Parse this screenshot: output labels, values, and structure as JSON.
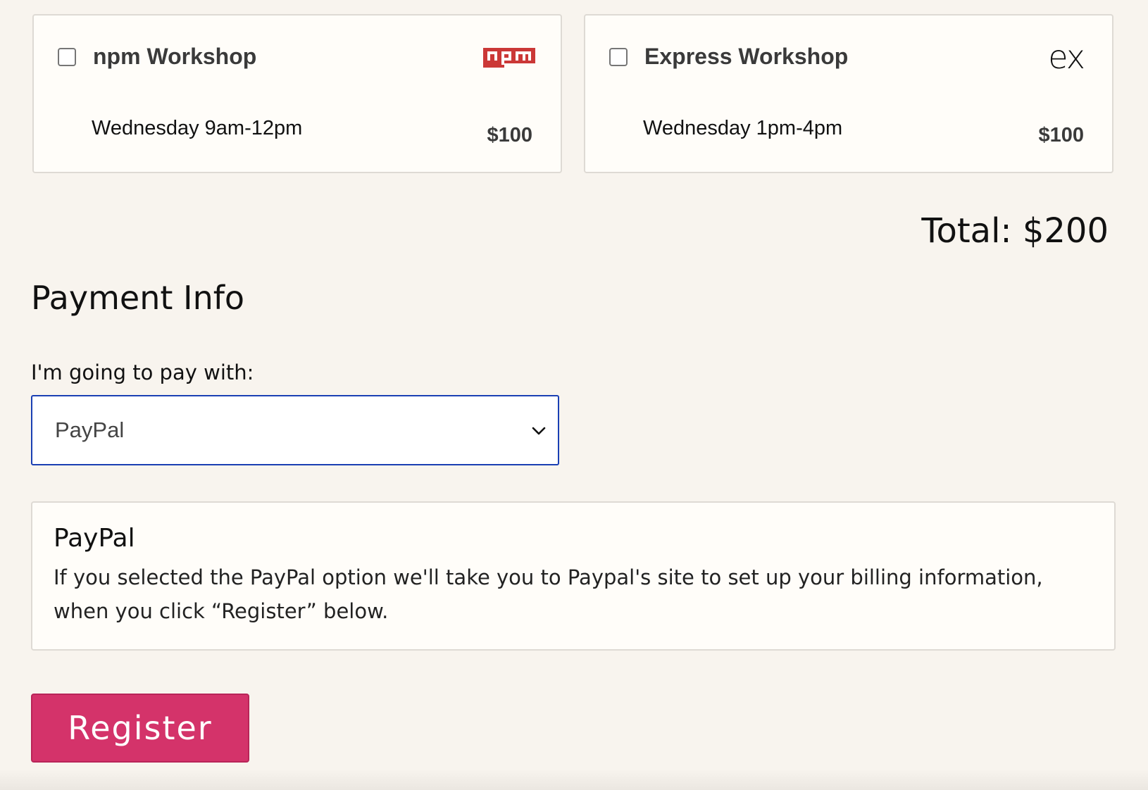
{
  "workshops": [
    {
      "title": "npm Workshop",
      "schedule": "Wednesday 9am-12pm",
      "price": "$100",
      "logo": "npm",
      "logo_color": "#cb3837",
      "checked": false
    },
    {
      "title": "Express Workshop",
      "schedule": "Wednesday 1pm-4pm",
      "price": "$100",
      "logo": "ex",
      "checked": false
    }
  ],
  "total": "Total: $200",
  "payment": {
    "section_title": "Payment Info",
    "label": "I'm going to pay with:",
    "selected": "PayPal",
    "info_title": "PayPal",
    "info_text": "If you selected the PayPal option we'll take you to Paypal's site to set up your billing information, when you click “Register” below."
  },
  "register_label": "Register",
  "colors": {
    "register_bg": "#d4336a",
    "select_border": "#1a3fb3",
    "page_bg": "#f8f4ee"
  }
}
